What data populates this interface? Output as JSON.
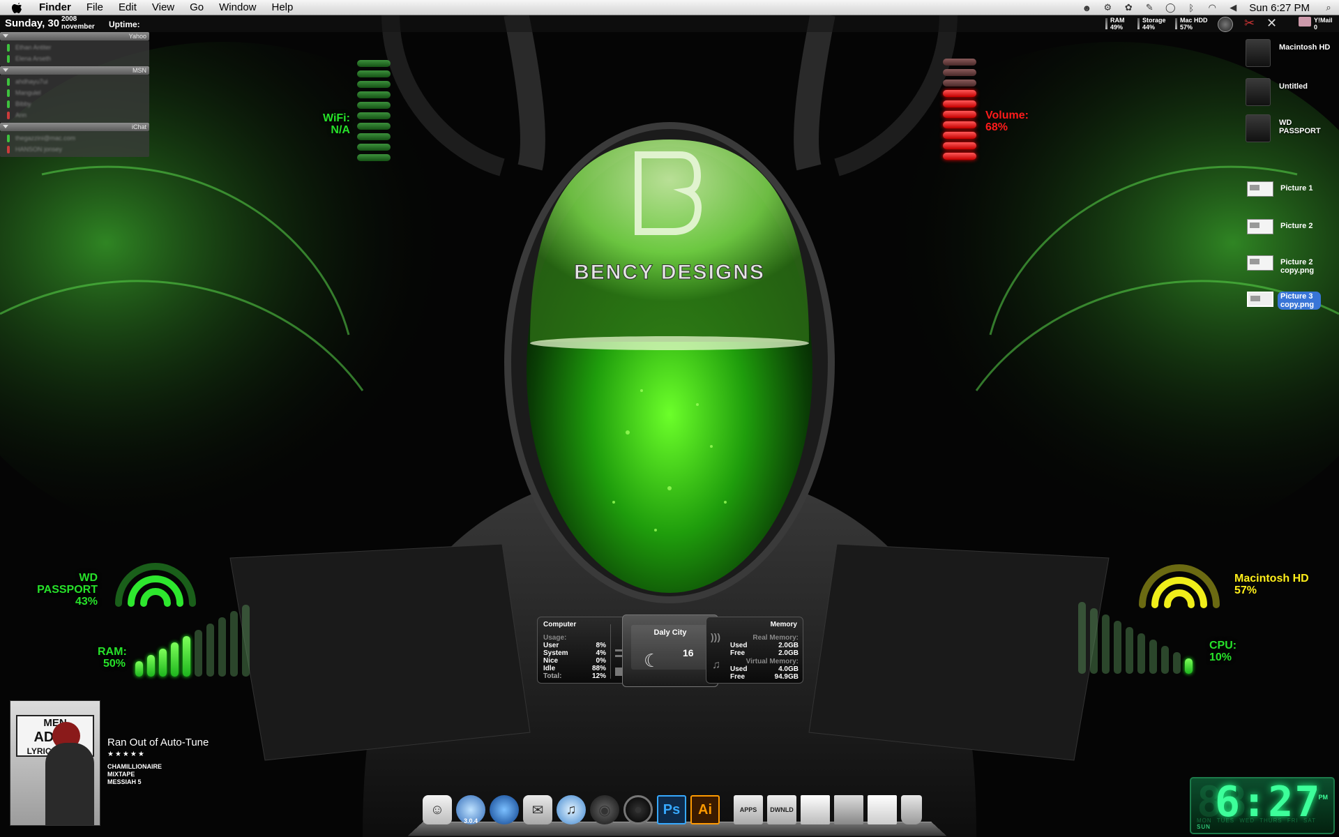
{
  "menubar": {
    "app_name": "Finder",
    "items": [
      "File",
      "Edit",
      "View",
      "Go",
      "Window",
      "Help"
    ],
    "clock": "Sun 6:27 PM"
  },
  "datebar": {
    "day": "Sunday, 30",
    "year": "2008",
    "month": "november",
    "uptime_label": "Uptime:"
  },
  "mini_stats": [
    {
      "label": "RAM",
      "value": "49%"
    },
    {
      "label": "Storage",
      "value": "44%"
    },
    {
      "label": "Mac HDD",
      "value": "57%"
    }
  ],
  "ymail": {
    "label": "Y!Mail",
    "count": "0"
  },
  "buddy_groups": [
    {
      "name": "Yahoo",
      "buddies": [
        {
          "status": "online",
          "name": "Ethan Antiter"
        },
        {
          "status": "online",
          "name": "Elena Arseth"
        }
      ]
    },
    {
      "name": "MSN",
      "buddies": [
        {
          "status": "online",
          "name": "ahdhayu7ui"
        },
        {
          "status": "online",
          "name": "Mangulel"
        },
        {
          "status": "online",
          "name": "Bibby"
        },
        {
          "status": "busy",
          "name": "Ann"
        }
      ]
    },
    {
      "name": "iChat",
      "buddies": [
        {
          "status": "online",
          "name": "thegazzini@mac.com"
        },
        {
          "status": "busy",
          "name": "HANSON jonsey"
        }
      ]
    }
  ],
  "wifi": {
    "label": "WiFi:",
    "value": "N/A"
  },
  "volume": {
    "label": "Volume:",
    "value": "68%",
    "level": 0.68
  },
  "wd_passport": {
    "label": "WD PASSPORT",
    "value": "43%"
  },
  "ram": {
    "label": "RAM:",
    "value": "50%",
    "level": 0.5
  },
  "macintosh_hd": {
    "label": "Macintosh HD",
    "value": "57%"
  },
  "cpu": {
    "label": "CPU:",
    "value": "10%",
    "level": 0.1
  },
  "drives": [
    {
      "name": "Macintosh HD"
    },
    {
      "name": "Untitled"
    },
    {
      "name": "WD PASSPORT"
    }
  ],
  "files": [
    {
      "name": "Picture 1",
      "selected": false
    },
    {
      "name": "Picture 2",
      "selected": false
    },
    {
      "name": "Picture 2 copy.png",
      "selected": false
    },
    {
      "name": "Picture 3 copy.png",
      "selected": true
    }
  ],
  "logo_text": "BENCY DESIGNS",
  "computer": {
    "title": "Computer",
    "usage_label": "Usage:",
    "rows": [
      {
        "k": "User",
        "v": "8%"
      },
      {
        "k": "System",
        "v": "4%"
      },
      {
        "k": "Nice",
        "v": "0%"
      },
      {
        "k": "Idle",
        "v": "88%"
      },
      {
        "k": "Total:",
        "v": "12%"
      }
    ]
  },
  "memory": {
    "title": "Memory",
    "real_label": "Real Memory:",
    "real": [
      {
        "k": "Used",
        "v": "2.0GB"
      },
      {
        "k": "Free",
        "v": "2.0GB"
      }
    ],
    "virtual_label": "Virtual Memory:",
    "virtual": [
      {
        "k": "Used",
        "v": "4.0GB"
      },
      {
        "k": "Free",
        "v": "94.9GB"
      }
    ]
  },
  "weather": {
    "city": "Daly City",
    "temp": "16"
  },
  "now_playing": {
    "track": "Ran Out of Auto-Tune",
    "stars": "★★★★★",
    "artist": "CHAMILLIONAIRE",
    "album": "MIXTAPE MESSIAH 5"
  },
  "dock": {
    "items": [
      {
        "name": "finder",
        "label": ""
      },
      {
        "name": "safari",
        "label": "3.0.4"
      },
      {
        "name": "globe",
        "label": ""
      },
      {
        "name": "mail",
        "label": ""
      },
      {
        "name": "itunes",
        "label": ""
      },
      {
        "name": "automator",
        "label": ""
      },
      {
        "name": "camera",
        "label": ""
      },
      {
        "name": "photoshop",
        "label": "Ps"
      },
      {
        "name": "illustrator",
        "label": "Ai"
      },
      {
        "name": "apps-stack",
        "label": "APPS"
      },
      {
        "name": "dwnld-stack",
        "label": "DWNLD"
      },
      {
        "name": "doc1",
        "label": ""
      },
      {
        "name": "doc2",
        "label": ""
      },
      {
        "name": "doc3",
        "label": ""
      },
      {
        "name": "trash",
        "label": ""
      }
    ]
  },
  "digital_clock": {
    "time": "6:27",
    "ampm": "PM",
    "days": [
      "MON",
      "TUES",
      "WED",
      "THURS",
      "FRI",
      "SAT",
      "SUN"
    ],
    "active_day": "SUN"
  },
  "colors": {
    "accent_green": "#27e22a",
    "accent_red": "#ff1b1b",
    "accent_yellow": "#ffef1a"
  }
}
